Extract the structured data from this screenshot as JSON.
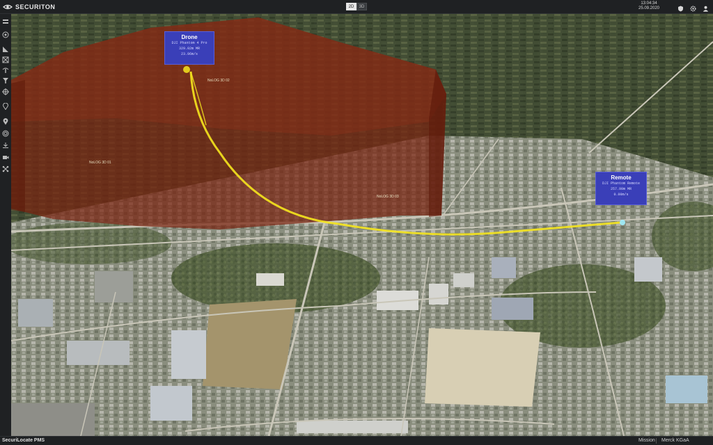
{
  "header": {
    "brand": "SECURITON",
    "view_modes": [
      "2D",
      "3D"
    ],
    "active_view": "2D",
    "time": "13:04:34",
    "date": "25.09.2020",
    "icons": [
      "shield-icon",
      "gear-icon",
      "user-icon"
    ]
  },
  "sidebar": {
    "icons": [
      "layers-icon",
      "target-icon",
      "measure-icon",
      "frame-icon",
      "antenna-icon",
      "filter-icon",
      "crosshair-icon",
      "pin-icon",
      "location-icon",
      "radar-icon",
      "download-icon",
      "camera-icon",
      "network-icon"
    ]
  },
  "map": {
    "drone": {
      "title": "Drone",
      "model": "DJI Phantom 4 Pro",
      "altitude": "329.02m MR",
      "speed": "23.96m/s"
    },
    "remote": {
      "title": "Remote",
      "model": "DJI Phantom Remote",
      "altitude": "257.90m MR",
      "speed": "0.00m/s"
    },
    "zone_labels": [
      "NoLOG 3D 02",
      "NoLOG 3D 01",
      "NoLOG 3D 03"
    ],
    "colors": {
      "restricted_zone": "#7a2410",
      "flight_path": "#f5e61e",
      "label_box": "#3a3fb8"
    }
  },
  "status": {
    "app_name": "SecuriLocate PMS",
    "mission_label": "Mission",
    "mission_value": "Merck KGaA"
  }
}
